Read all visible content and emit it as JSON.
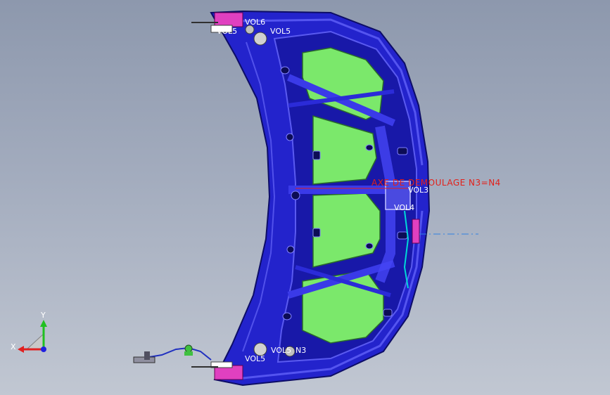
{
  "viewport": {
    "background_top": "#8d98ad",
    "background_bottom": "#c1c7d2",
    "part_colors": {
      "frame": "#2020c8",
      "frame_dark": "#10107a",
      "panel": "#7ae86a",
      "bracket": "#e040c0",
      "accent": "#00e0e0"
    }
  },
  "annotations": {
    "vol6": "VOL6",
    "vol5_top": "VOL5",
    "vol5_top_prefix": "VOL5",
    "axe_demoulage": "AXE DE DEMOULAGE   N3=N4",
    "vol3": "VOL3",
    "vol4": "VOL4",
    "vol5_bottom_left": "VOL5",
    "vol5_bottom_right": "VOL5",
    "n3": "N3"
  },
  "triad": {
    "x_label": "X",
    "y_label": "Y",
    "x_color": "#e02020",
    "y_color": "#20c020",
    "z_color": "#2020e0"
  }
}
